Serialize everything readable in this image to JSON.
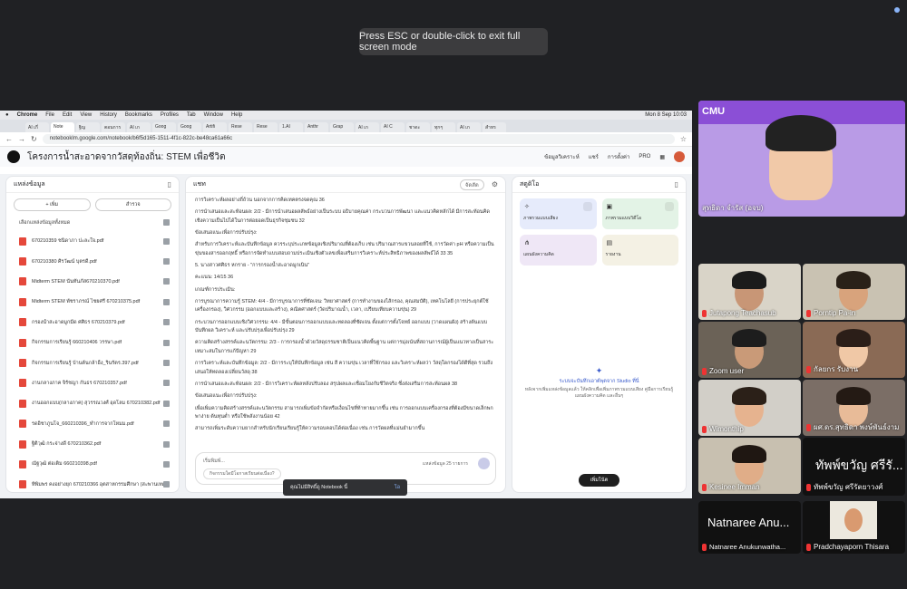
{
  "fullscreen_banner": "Press ESC or double-click to exit full screen mode",
  "mac_menu": {
    "app": "Chrome",
    "items": [
      "File",
      "Edit",
      "View",
      "History",
      "Bookmarks",
      "Profiles",
      "Tab",
      "Window",
      "Help"
    ],
    "datetime": "Mon 8 Sep 10:03"
  },
  "browser": {
    "tabs": [
      "AI เกี่",
      "Note",
      "ฐิญ",
      "ตอนการ",
      "AI เก",
      "Goog",
      "Goog",
      "Artifi",
      "Rese",
      "Rese",
      "1.AI",
      "Anthr",
      "Grap",
      "AI เก",
      "AI C",
      "ชาดะ",
      "ทุกๆ",
      "AI เก",
      "สำหร"
    ],
    "url": "notebooklm.google.com/notebook/b6f5d165-1511-4f1c-822c-be48ca61a66c"
  },
  "notebook": {
    "title": "โครงการน้ำสะอาดจากวัสดุท้องถิ่น: STEM เพื่อชีวิต",
    "actions": [
      "ข้อมูลวิเคราะห์",
      "แชร์",
      "การตั้งค่า",
      "PRO"
    ]
  },
  "sources": {
    "header": "แหล่งข้อมูล",
    "add": "+ เพิ่ม",
    "explore": "สำรวจ",
    "select_all": "เลือกแหล่งข้อมูลทั้งหมด",
    "items": [
      "670210359 ชนิดาภา ปะละใจ.pdf",
      "670210380 ศิรวัฒน์ บุตรดี.pdf",
      "Midterm STEM นันทันภัส670210370.pdf",
      "Midterm STEM พัชราภรณ์ ไชยศรี 670210375.pdf",
      "กรองน้ำสะอาดมูกมีด ศศิธร 670210379.pdf",
      "กิจกรรมการเรียนรู้ 660210406 วรรษา.pdf",
      "กิจกรรมการเรียนรู้ บ้านต้นกล้าอิ้ง_รินรัตร.397.pdf",
      "งานกลางภาค จิรัชญา กันธร 670210357.pdf",
      "งานออกแบบ(กลางภาค) สุวรรณวงศ์ อุดโลม 670210382.pdf",
      "รดอิชาภูนโจ_660210396_ทำการจากโหมม.pdf",
      "ฐิติวุฒิ กระจ่างดี 670210362.pdf",
      "ณัฐวุฒิ ต่อเติม 660210398.pdf",
      "ทิพิมพร คงอย่างยุก 670210366 อุตสาหกรรมศึกษา (สะพานเทค..."
    ]
  },
  "chat": {
    "header": "แชท",
    "save_label": "จัดสัด",
    "paragraphs": [
      "การวิเคราะห์ผลอย่างถี่ถ้วน นอกจากการคิดเทคตรงจดคุณ 36",
      "การนำเสนอและสะท้อนผล: 2/2 - มีการนำเสนอผลลัพธ์อย่างเป็นระบบ อธิบายคุณค่า กระบวนการพัฒนา และแนวคิดหลักได้ มีการสะท้อนคิดเชิงความเป็นไปได้ในการต่อยอดเป็นธุรกิจชุมชน 32",
      "ข้อเสนอแนะเพื่อการปรับปรุง:",
      "สำหรับการวิเคราะห์และบันทึกข้อมูล ควรระบุประเภทข้อมูลเชิงปริมาณที่ต้องเก็บ เช่น ปริมาณสารแขวนลอยที่ใช้, การวัดค่า pH หรือความเป็นขุ่นของสารออกฤทธิ์ หรือการจัดทำแบบสอบถามประเมินเชิงตัวเลขเพื่อเสริมการวิเคราะห์ประสิทธิภาพของผลลัพธ์ได้ 33 35",
      "5. นางสาวศศิธร หกราย - \"การกรองน้ำสะอาดมูกเนิน\"",
      "คะแนน: 14/15 36",
      "เกณฑ์การประเมิน:",
      "การบูรณาการความรู้ STEM: 4/4 - มีการบูรณาการที่ชัดเจน: วิทยาศาสตร์ (การทำงานของไส้กรอง, คุณสมบัติ), เทคโนโลยี (การประยุกต์ใช้เครื่องกรอง), วิศวกรรม (ออกแบบและสร้าง), คณิตศาสตร์ (วัดปริมาณน้ำ, เวลา, เปรียบเทียบความขุ่น) 29",
      "กระบวนการออกแบบเชิงวิศวกรรม: 4/4 - มีขั้นตอนการออกแบบและทดลองที่ชัดเจน ตั้งแต่การตั้งโจทย์ ออกแบบ (วาดแผนผัง) สร้างต้นแบบ บันทึกผล วิเคราะห์ และปรับปรุงเพื่อปรับปรุง 29",
      "ความคิดสร้างสรรค์และนวัตกรรม: 2/3 - การกรองน้ำด้วยวัสดุธรรมชาติเป็นแนวคิดพื้นฐาน แต่การมุ่งเน้นที่สถานการณ์ผู้เป็นแนวทางเป็นสาระเหมาะสมในการแก้ปัญหา 29",
      "การวิเคราะห์และบันทึกข้อมูล: 2/2 - มีการระบุให้บันทึกข้อมูล เช่น สี ความขุ่น เวลาที่ใช้กรอง และวิเคราะห์ผลว่า วัสดุใดกรองได้ดีที่สุด รวมถึงเสนอให้ทดลองเปลี่ยนวัสดุ 38",
      "การนำเสนอและสะท้อนผล: 2/2 - มีการวิเคราะห์ผลหลังปรับลอง สรุปผลและเชื่อมโยงกับชีวิตจริง ซึ่งส่งเสริมการสะท้อนผล 38",
      "ข้อเสนอแนะเพื่อการปรับปรุง:",
      "เพื่อเพิ่มความคิดสร้างสรรค์และนวัตกรรม สามารถเพิ่มข้อจำกัดหรือเงื่อนไขที่ท้าทายมากขึ้น เช่น การออกแบบเครื่องกรองที่ต้องมีขนาดเล็กพกพาง่าย ต้นทุนต่ำ หรือใช้พลังงานน้อย 42",
      "สามารถเพิ่มระดับความยากสำหรับนักเรียนเรียนรู้ให้ความรอบคอบได้ต่อเนื่อง เช่น การวัดผลที่แม่นยำมากขึ้น"
    ],
    "input_placeholder": "เริ่มพิมพ์...",
    "source_count": "แหล่งข้อมูล 25 รายการ",
    "suggestion": "กิจกรรมใดมีโอกาสเรียนต่อเนื่อง?",
    "toast": "คุณไม่มีสิทธิ์ดู Notebook นี้",
    "toast_action": "โอ"
  },
  "studio": {
    "header": "สตูดิโอ",
    "cards": [
      {
        "icon": "audio-overview-icon",
        "label": "ภาพรวมแบบเสียง"
      },
      {
        "icon": "video-overview-icon",
        "label": "ภาพรวมแบบวิดีโอ"
      },
      {
        "icon": "mind-map-icon",
        "label": "แผนผังความคิด"
      },
      {
        "icon": "report-icon",
        "label": "รายงาน"
      }
    ],
    "empty_title": "ระบบจะบันทึกเอาต์พุตจาก Studio ที่นี่",
    "empty_desc": "หลังจากเพิ่มแหล่งข้อมูลแล้ว ให้คลิกเพื่อเพิ่มภาพรวมแบบเสียง คู่มือการเรียนรู้ แผนผังความคิด และอื่นๆ",
    "add_note": "เพิ่มโน้ต"
  },
  "participants": [
    {
      "name": "สุทธิดา จำรัส (อจบ)",
      "muted": false
    },
    {
      "name": "Jutapong Teachasub",
      "muted": true
    },
    {
      "name": "Porntip Pa-in",
      "muted": true
    },
    {
      "name": "Zoom user",
      "muted": true
    },
    {
      "name": "กัลยกร รับงาน",
      "muted": true
    },
    {
      "name": "Wimonthip",
      "muted": true
    },
    {
      "name": "ผศ.ดร.สุทธิดา พงษ์พันธ์งาม",
      "muted": true
    },
    {
      "name": "Kesinee Imman",
      "muted": true
    },
    {
      "name": "ทัพพ์ขวัญ ศรีรัตยาวงศ์",
      "muted": true,
      "big": "ทัพพ์ขวัญ ศรีรั..."
    },
    {
      "name": "Natnaree Anukunwatha...",
      "muted": true,
      "big": "Natnaree Anu..."
    },
    {
      "name": "Pradchayaporn Thisara",
      "muted": true
    }
  ],
  "colors": {
    "accent": "#3b5ccc",
    "pdf": "#e5483b",
    "cmu_banner": "#8b4fd6"
  }
}
